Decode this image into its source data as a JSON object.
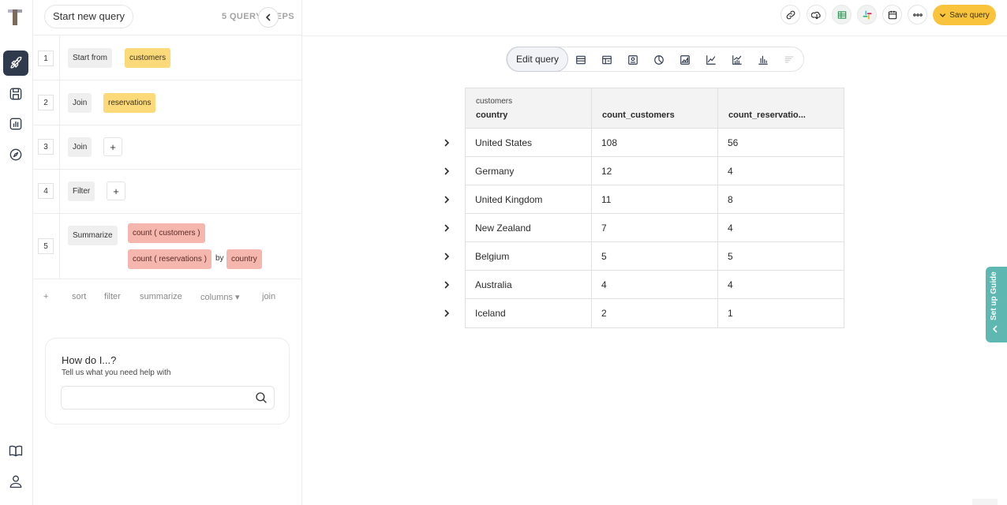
{
  "header": {
    "start_new_query": "Start new query",
    "steps_count": "5 QUERY STEPS",
    "collapse_icon": "chevron-left"
  },
  "steps": [
    {
      "num": "1",
      "action": "Start from",
      "table": "customers"
    },
    {
      "num": "2",
      "action": "Join",
      "table": "reservations"
    },
    {
      "num": "3",
      "action": "Join",
      "plus": "+"
    },
    {
      "num": "4",
      "action": "Filter",
      "plus": "+"
    },
    {
      "num": "5",
      "action": "Summarize",
      "agg1": "count ( customers )",
      "agg2": "count ( reservations )",
      "by": "by",
      "group_by": "country"
    }
  ],
  "actions": {
    "plus": "+",
    "sort": "sort",
    "filter": "filter",
    "summarize": "summarize",
    "columns": "columns ▾",
    "join": "join"
  },
  "help": {
    "title": "How do I...?",
    "subtitle": "Tell us what you need help with",
    "input_value": ""
  },
  "toolbar": {
    "save_label": "Save query",
    "accent": "#f9c43b"
  },
  "viz": {
    "edit_query": "Edit query",
    "icons": [
      "table-icon",
      "pivot-icon",
      "kpi-icon",
      "pie-icon",
      "area-icon",
      "line-icon",
      "combo-icon",
      "bar-icon",
      "funnel-icon"
    ]
  },
  "table": {
    "source_label": "customers",
    "columns": [
      "country",
      "count_customers",
      "count_reservatio..."
    ],
    "rows": [
      [
        "United States",
        "108",
        "56"
      ],
      [
        "Germany",
        "12",
        "4"
      ],
      [
        "United Kingdom",
        "11",
        "8"
      ],
      [
        "New Zealand",
        "7",
        "4"
      ],
      [
        "Belgium",
        "5",
        "5"
      ],
      [
        "Australia",
        "4",
        "4"
      ],
      [
        "Iceland",
        "2",
        "1"
      ]
    ]
  },
  "guide": {
    "label": "Set up Guide",
    "color": "#5fb7b1"
  }
}
